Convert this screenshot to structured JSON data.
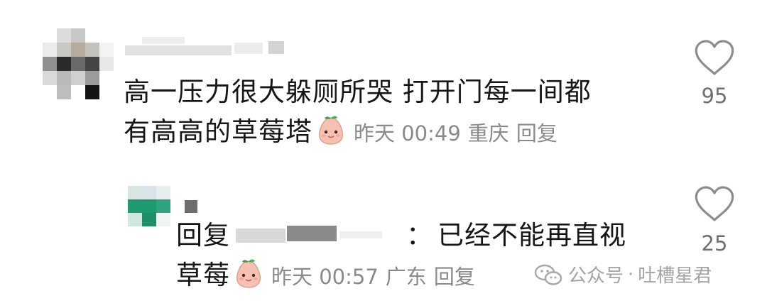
{
  "comment": {
    "line1": "高一压力很大躲厕所哭 打开门每一间都",
    "line2": "有高高的草莓塔",
    "emoji": "strawberry-face-emoji",
    "time": "昨天 00:49",
    "location": "重庆",
    "reply_label": "回复",
    "likes": "95",
    "like_icon": "heart-outline-icon"
  },
  "reply": {
    "prefix": "回复",
    "colon": "：",
    "line1_text": "已经不能再直视",
    "line2": "草莓",
    "emoji": "strawberry-face-emoji",
    "time": "昨天 00:57",
    "location": "广东",
    "reply_label": "回复",
    "likes": "25",
    "like_icon": "heart-outline-icon"
  },
  "watermark": {
    "icon": "wechat-official-account-icon",
    "text": "公众号",
    "separator": "·",
    "account": "吐槽星君"
  },
  "colors": {
    "text_primary": "#161616",
    "text_meta": "#8a8a8a",
    "like_count": "#6f6f6f",
    "emoji_pink": "#f6c1b3",
    "emoji_leaf": "#3f9e4b"
  }
}
